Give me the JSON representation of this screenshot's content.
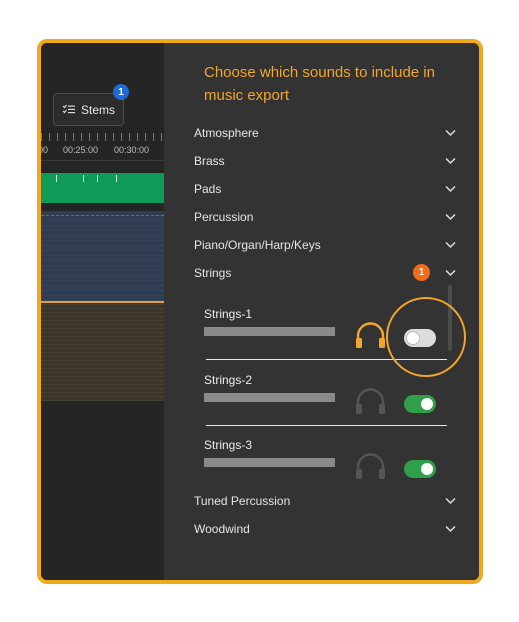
{
  "toolbar": {
    "stems_label": "Stems",
    "stems_badge": "1"
  },
  "timeline": {
    "ruler_labels": [
      "00",
      "00:25:00",
      "00:30:00"
    ]
  },
  "panel": {
    "title": "Choose which sounds to include in music export",
    "categories": [
      {
        "label": "Atmosphere"
      },
      {
        "label": "Brass"
      },
      {
        "label": "Pads"
      },
      {
        "label": "Percussion"
      },
      {
        "label": "Piano/Organ/Harp/Keys"
      },
      {
        "label": "Strings",
        "badge": "1",
        "expanded": true
      },
      {
        "label": "Tuned Percussion"
      },
      {
        "label": "Woodwind"
      }
    ],
    "stems": [
      {
        "name": "Strings-1",
        "headphones": "headphones-icon-active",
        "enabled": false
      },
      {
        "name": "Strings-2",
        "headphones": "headphones-icon",
        "enabled": true
      },
      {
        "name": "Strings-3",
        "headphones": "headphones-icon",
        "enabled": true
      }
    ]
  },
  "colors": {
    "accent": "#f2a72a",
    "toggle_on": "#2f9f4a",
    "badge_blue": "#1e6ad6",
    "badge_orange": "#f06d1c"
  }
}
